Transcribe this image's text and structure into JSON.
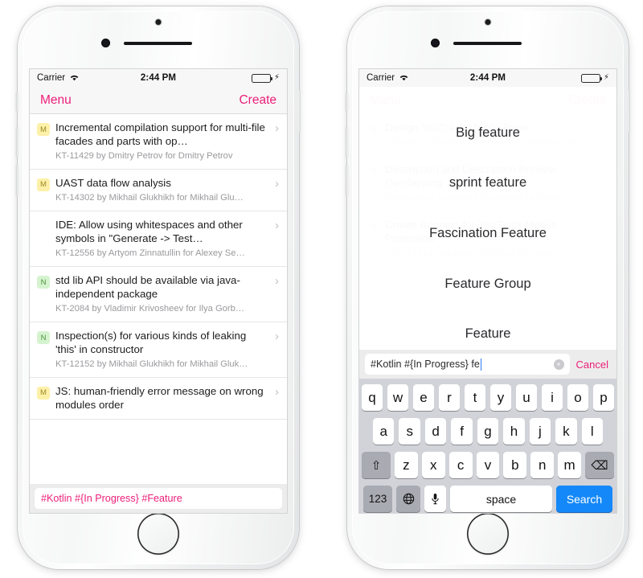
{
  "status_bar": {
    "carrier": "Carrier",
    "wifi_icon": "wifi-icon",
    "time": "2:44 PM",
    "battery_icon": "battery-icon",
    "charging_icon": "lightning-bolt-icon"
  },
  "nav": {
    "menu_label": "Menu",
    "create_label": "Create",
    "accent_color": "#ec1e79"
  },
  "left_phone": {
    "issues": [
      {
        "badge": "M",
        "badge_type": "m",
        "title": "Incremental compilation support for multi-file facades and parts with op…",
        "subtitle": "KT-11429 by Dmitry Petrov for Dmitry Petrov",
        "chevron": "›"
      },
      {
        "badge": "M",
        "badge_type": "m",
        "title": "UAST data flow analysis",
        "subtitle": "KT-14302 by Mikhail Glukhikh for Mikhail Glu…",
        "chevron": "›"
      },
      {
        "badge": "",
        "badge_type": "blank",
        "title": "IDE: Allow using whitespaces and other symbols in \"Generate -> Test…",
        "subtitle": "KT-12556 by Artyom Zinnatullin for Alexey Se…",
        "chevron": "›"
      },
      {
        "badge": "N",
        "badge_type": "n",
        "title": "std lib API should be available via java-independent package",
        "subtitle": "KT-2084 by Vladimir Krivosheev for Ilya Gorb…",
        "chevron": "›"
      },
      {
        "badge": "N",
        "badge_type": "n",
        "title": "Inspection(s) for various kinds of leaking 'this' in constructor",
        "subtitle": "KT-12152 by Mikhail Glukhikh for Mikhail Gluk…",
        "chevron": "›"
      },
      {
        "badge": "M",
        "badge_type": "m",
        "title": "JS: human-friendly error message on wrong modules order",
        "subtitle": "",
        "chevron": "›"
      }
    ],
    "query_bar": {
      "value": "#Kotlin #{In Progress} #Feature"
    }
  },
  "right_phone": {
    "background_issues": [
      {
        "badge": "N",
        "badge_type": "n",
        "title": "Design YouTrack Mobile Page",
        "subtitle": "YTM-84 by Svetlana Shumilova for Svetlana Sh…",
        "chevron": "›"
      },
      {
        "badge": "N",
        "badge_type": "n",
        "title": "Description and Description Preview Overlapping",
        "subtitle": "Mobile-4104 by Wanna Shumilova for Sveta…",
        "chevron": "›"
      },
      {
        "badge": "N",
        "badge_type": "n",
        "title": "Create Banners for YouTrack Mobile Promotion",
        "subtitle": "YTM-148 by Svetlana Shumilova for Sveta…",
        "chevron": "›"
      }
    ],
    "suggestions": [
      "Big feature",
      "sprint feature",
      "Fascination Feature",
      "Feature Group",
      "Feature"
    ],
    "search": {
      "value": "#Kotlin #{In Progress} fe",
      "clear_icon": "×",
      "cancel_label": "Cancel"
    },
    "keyboard": {
      "row1": [
        "q",
        "w",
        "e",
        "r",
        "t",
        "y",
        "u",
        "i",
        "o",
        "p"
      ],
      "row2": [
        "a",
        "s",
        "d",
        "f",
        "g",
        "h",
        "j",
        "k",
        "l"
      ],
      "row3": [
        "z",
        "x",
        "c",
        "v",
        "b",
        "n",
        "m"
      ],
      "shift_icon": "⇧",
      "delete_icon": "⌫",
      "numbers_label": "123",
      "globe_icon": "⊕",
      "mic_icon": "⬛",
      "space_label": "space",
      "search_label": "Search"
    }
  }
}
